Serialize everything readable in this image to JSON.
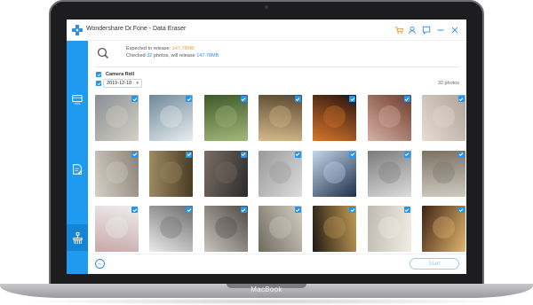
{
  "laptop": {
    "brand": "MacBook"
  },
  "app": {
    "title": "Wondershare Dr.Fone - Data Eraser",
    "accent": "#1e9af0",
    "titlebar_icons": [
      "cart-icon",
      "user-icon",
      "feedback-icon",
      "minimize-icon",
      "close-icon"
    ]
  },
  "sidebar": {
    "items": [
      {
        "icon": "phone-data-icon",
        "active": false
      },
      {
        "icon": "document-edit-icon",
        "active": false
      },
      {
        "icon": "eraser-icon",
        "active": true
      }
    ]
  },
  "info": {
    "line1_prefix": "Expected to release: ",
    "line1_value": "147.78MB",
    "line2_prefix": "Checked ",
    "line2_count": "32",
    "line2_mid": " photos, will release ",
    "line2_value": "147.78MB"
  },
  "section": {
    "album_label": "Camera Roll",
    "date_value": "2019-12-18",
    "photo_count": "32 photos"
  },
  "photos": [
    {
      "icon": "photo-beach-icon",
      "colors": [
        "#8a8f94",
        "#d4d1c6"
      ]
    },
    {
      "icon": "photo-mountain-icon",
      "colors": [
        "#6f8898",
        "#e8eef2"
      ]
    },
    {
      "icon": "photo-portrait-icon",
      "colors": [
        "#3e5a2a",
        "#a2b77a"
      ]
    },
    {
      "icon": "photo-plant-icon",
      "colors": [
        "#5b4a30",
        "#d6b98b"
      ]
    },
    {
      "icon": "photo-neon-sign-icon",
      "colors": [
        "#241210",
        "#d9772a"
      ]
    },
    {
      "icon": "photo-flower-icon",
      "colors": [
        "#6d3b2b",
        "#d7b2a6"
      ]
    },
    {
      "icon": "photo-wall-icon",
      "colors": [
        "#b1a49a",
        "#e5dcd2"
      ]
    },
    {
      "icon": "photo-hand-icon",
      "colors": [
        "#8d8377",
        "#d5cfc6"
      ]
    },
    {
      "icon": "photo-glass-icon",
      "colors": [
        "#4a3b22",
        "#9e8a63"
      ]
    },
    {
      "icon": "photo-interior-icon",
      "colors": [
        "#2b2b2b",
        "#7a6e64"
      ]
    },
    {
      "icon": "photo-window-icon",
      "colors": [
        "#ddd",
        "#999"
      ]
    },
    {
      "icon": "photo-vr-headset-icon",
      "colors": [
        "#1d2f4a",
        "#c6d7ea"
      ]
    },
    {
      "icon": "photo-blinds-portrait-icon",
      "colors": [
        "#dcdcdc",
        "#7b7b7b"
      ]
    },
    {
      "icon": "photo-shelf-icon",
      "colors": [
        "#cfcac0",
        "#7c7366"
      ]
    },
    {
      "icon": "photo-cup-icon",
      "colors": [
        "#c9a7a8",
        "#eee"
      ]
    },
    {
      "icon": "photo-building-icon",
      "colors": [
        "#eaeaea",
        "#6d6d6d"
      ]
    },
    {
      "icon": "photo-figure-icon",
      "colors": [
        "#c9c4bd",
        "#4f4a44"
      ]
    },
    {
      "icon": "photo-leaves-icon",
      "colors": [
        "#6e6a5d",
        "#d4cfc2"
      ]
    },
    {
      "icon": "photo-lights-icon",
      "colors": [
        "#1f1a14",
        "#c39c55"
      ]
    },
    {
      "icon": "photo-window-light-icon",
      "colors": [
        "#bfbab0",
        "#f1eee6"
      ]
    },
    {
      "icon": "photo-food-icon",
      "colors": [
        "#3d2414",
        "#e3b56f"
      ]
    },
    {
      "icon": "photo-person-blue-icon",
      "colors": [
        "#2d69b4",
        "#a9c9ea"
      ]
    }
  ],
  "footer": {
    "back_glyph": "←",
    "start_label": "Start"
  }
}
